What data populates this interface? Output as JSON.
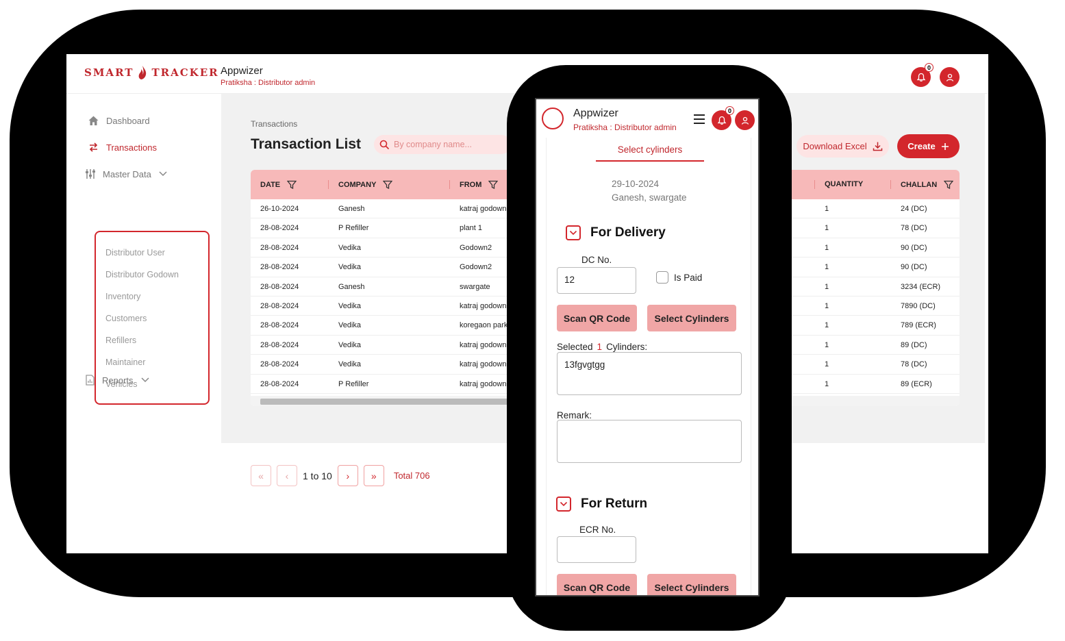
{
  "desktop": {
    "logo": {
      "left": "SMART",
      "right": "TRACKER"
    },
    "app_name": "Appwizer",
    "user_line": "Pratiksha : Distributor admin",
    "notif_count": "0",
    "sidebar": {
      "dashboard": "Dashboard",
      "transactions": "Transactions",
      "master_data": "Master Data",
      "sub_items": [
        "Distributor User",
        "Distributor Godown",
        "Inventory",
        "Customers",
        "Refillers",
        "Maintainer",
        "Vehicles"
      ],
      "reports": "Reports"
    },
    "breadcrumb": "Transactions",
    "page_title": "Transaction List",
    "search_placeholder": "By company name...",
    "download_label": "Download Excel",
    "create_label": "Create",
    "table": {
      "headers": {
        "date": "DATE",
        "company": "COMPANY",
        "from": "FROM",
        "quantity": "QUANTITY",
        "challan": "CHALLAN"
      },
      "rows": [
        {
          "date": "26-10-2024",
          "company": "Ganesh",
          "from": "katraj godown",
          "quantity": "1",
          "challan": "24 (DC)"
        },
        {
          "date": "28-08-2024",
          "company": "P Refiller",
          "from": "plant 1",
          "quantity": "1",
          "challan": "78 (DC)"
        },
        {
          "date": "28-08-2024",
          "company": "Vedika",
          "from": "Godown2",
          "quantity": "1",
          "challan": "90 (DC)"
        },
        {
          "date": "28-08-2024",
          "company": "Vedika",
          "from": "Godown2",
          "quantity": "1",
          "challan": "90 (DC)"
        },
        {
          "date": "28-08-2024",
          "company": "Ganesh",
          "from": "swargate",
          "quantity": "1",
          "challan": "3234 (ECR)"
        },
        {
          "date": "28-08-2024",
          "company": "Vedika",
          "from": "katraj godown",
          "quantity": "1",
          "challan": "7890 (DC)"
        },
        {
          "date": "28-08-2024",
          "company": "Vedika",
          "from": "koregaon park",
          "quantity": "1",
          "challan": "789 (ECR)"
        },
        {
          "date": "28-08-2024",
          "company": "Vedika",
          "from": "katraj godown",
          "quantity": "1",
          "challan": "89 (DC)"
        },
        {
          "date": "28-08-2024",
          "company": "Vedika",
          "from": "katraj godown",
          "quantity": "1",
          "challan": "78 (DC)"
        },
        {
          "date": "28-08-2024",
          "company": "P Refiller",
          "from": "katraj godown",
          "quantity": "1",
          "challan": "89 (ECR)"
        }
      ]
    },
    "pagination": {
      "range": "1 to 10",
      "total": "Total 706",
      "first": "«",
      "prev": "‹",
      "next": "›",
      "last": "»"
    }
  },
  "mobile": {
    "app_name": "Appwizer",
    "user_line": "Pratiksha : Distributor admin",
    "notif_count": "0",
    "tab": "Select cylinders",
    "date": "29-10-2024",
    "place": "Ganesh,  swargate",
    "delivery": {
      "title": "For Delivery",
      "dc_label": "DC No.",
      "dc_value": "12",
      "is_paid": "Is Paid",
      "scan_label": "Scan QR Code",
      "select_label": "Select Cylinders",
      "selected_prefix": "Selected",
      "selected_count": "1",
      "selected_suffix": "Cylinders:",
      "cylinders_value": "13fgvgtgg",
      "remark_label": "Remark:"
    },
    "return": {
      "title": "For Return",
      "ecr_label": "ECR No.",
      "scan_label": "Scan QR Code",
      "select_label": "Select Cylinders"
    }
  },
  "colors": {
    "brand_red": "#d3262c",
    "header_pink": "#f7b9b9",
    "button_pink": "#f0a6a6"
  }
}
